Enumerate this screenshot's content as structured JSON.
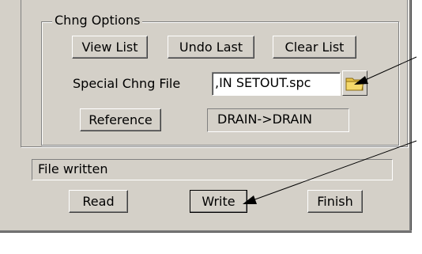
{
  "chng_options": {
    "title": "Chng Options",
    "view_list_label": "View List",
    "undo_last_label": "Undo Last",
    "clear_list_label": "Clear List",
    "special_chng_file_label": "Special Chng File",
    "special_chng_file_value": ",IN SETOUT.spc",
    "reference_label": "Reference",
    "reference_value": "DRAIN->DRAIN"
  },
  "status": {
    "message": "File written"
  },
  "actions": {
    "read_label": "Read",
    "write_label": "Write",
    "finish_label": "Finish"
  },
  "icons": {
    "browse": "folder-icon",
    "callout": "arrow-icon"
  }
}
